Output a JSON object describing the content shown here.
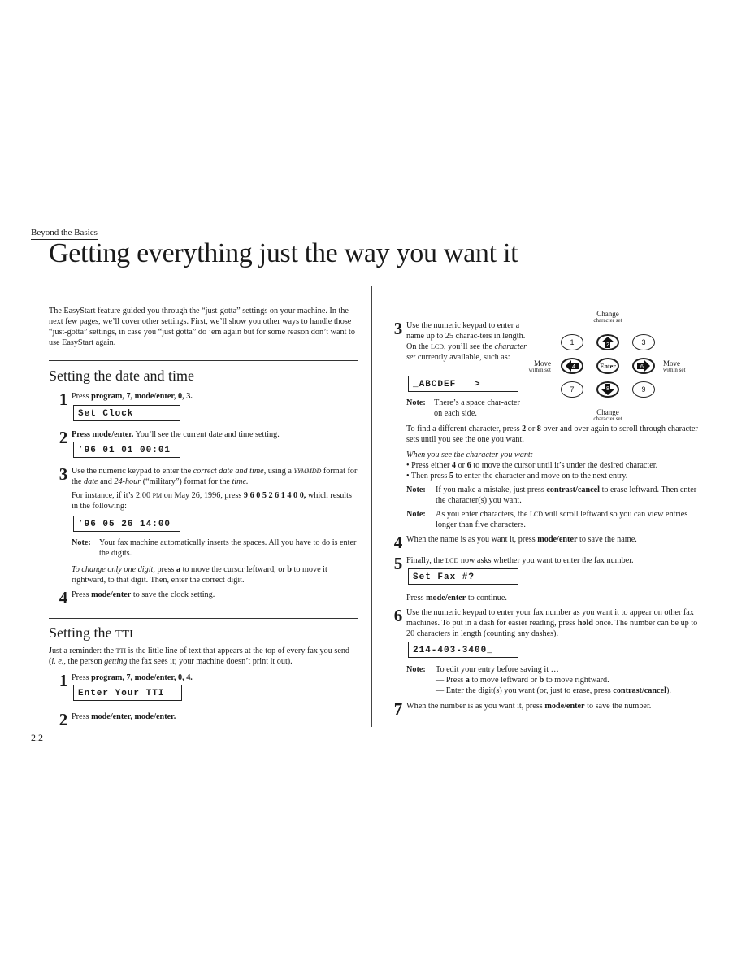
{
  "header": {
    "section_label": "Beyond the Basics",
    "title": "Getting everything just the way you want it"
  },
  "intro": "The EasyStart feature guided you through the “just-gotta” settings on your machine. In the next few pages, we’ll cover other settings. First, we’ll show you other ways to handle those “just-gotta” settings, in case you “just gotta” do ’em again but for some reason don’t want to use EasyStart again.",
  "date_time": {
    "heading": "Setting the date and time",
    "step1": {
      "num": "1",
      "pre": "Press ",
      "bold": "program, 7, mode/enter, 0, 3.",
      "lcd": "Set Clock"
    },
    "step2": {
      "num": "2",
      "bold": "Press mode/enter.",
      "rest": " You’ll see the current date and time setting.",
      "lcd": "’96 01 01 00:01"
    },
    "step3": {
      "num": "3",
      "line_a": "Use the numeric keypad to enter the",
      "italic_a": "correct date and time",
      "line_b": ", using a",
      "format": "YYMMDD",
      "line_c": "format for the",
      "italic_date": "date",
      "line_d": "and",
      "italic_24": "24-hour",
      "line_e": "(“military”) format for the",
      "italic_time": "time.",
      "example_pre": "For instance, if it’s 2:00",
      "pm": "PM",
      "example_mid": "on May 26, 1996, press",
      "example_keys": "9 6 0 5 2 6 1 4 0 0,",
      "example_post": "which results in the following:",
      "lcd": "’96 05 26 14:00",
      "note_label": "Note:",
      "note_text": "Your fax machine automatically inserts the spaces. All you have to do is enter the digits.",
      "change_italic": "To change only one digit,",
      "change_text_a": "press",
      "key_a": "a",
      "change_text_b": "to move the cursor leftward, or",
      "key_b": "b",
      "change_text_c": "to move it rightward, to that digit. Then, enter the correct digit."
    },
    "step4": {
      "num": "4",
      "pre": "Press ",
      "bold": "mode/enter",
      "rest": " to save the clock setting."
    }
  },
  "tti": {
    "heading_pre": "Setting the",
    "heading_sc": "TTI",
    "intro_a": "Just a reminder: the",
    "intro_sc": "TTI",
    "intro_b": "is the little line of text that appears at the top of every fax you send (",
    "intro_ie": "i. e.,",
    "intro_c": "the person",
    "intro_getting": "getting",
    "intro_d": "the fax sees it; your machine doesn’t print it out).",
    "step1": {
      "num": "1",
      "pre": "Press ",
      "bold": "program, 7, mode/enter, 0, 4.",
      "lcd": "Enter Your TTI"
    },
    "step2": {
      "num": "2",
      "pre": "Press ",
      "bold": "mode/enter, mode/enter."
    },
    "step3": {
      "num": "3",
      "text_a": "Use the numeric keypad to enter a name up to 25 charac-ters in length. On the",
      "sc_lcd": "LCD",
      "text_b": ", you’ll see the",
      "italic": "character set",
      "text_c": "currently available, such as:",
      "lcd": "_ABCDEF   >",
      "note_label": "Note:",
      "note_text": "There’s a space char-acter on each side.",
      "find_a": "To find a different character, press",
      "find_k1": "2",
      "find_or": "or",
      "find_k2": "8",
      "find_b": "over and over again to scroll through character sets until you see the one you want.",
      "when_italic": "When you see the character you want:",
      "bullet1_a": "• Press either",
      "bullet1_k1": "4",
      "bullet1_or": "or",
      "bullet1_k2": "6",
      "bullet1_b": "to move the cursor until it’s under the desired character.",
      "bullet2_a": "• Then press",
      "bullet2_k": "5",
      "bullet2_b": "to enter the character and move on to the next entry.",
      "note2_label": "Note:",
      "note2_a": "If you make a mistake, just press",
      "note2_bold": "contrast/cancel",
      "note2_b": "to erase leftward. Then enter the character(s) you want.",
      "note3_label": "Note:",
      "note3_a": "As you enter characters, the",
      "note3_sc": "LCD",
      "note3_b": "will scroll leftward so you can view entries longer than five characters."
    },
    "keypad": {
      "top_label_a": "Change",
      "top_label_b": "character set",
      "bottom_label_a": "Change",
      "bottom_label_b": "character set",
      "left_label_a": "Move",
      "left_label_b": "within set",
      "right_label_a": "Move",
      "right_label_b": "within set",
      "keys": [
        "1",
        "2",
        "3",
        "4",
        "Enter",
        "6",
        "7",
        "8",
        "9"
      ]
    },
    "step4": {
      "num": "4",
      "pre": "When the name is as you want it, press ",
      "bold": "mode/enter",
      "rest": " to save the name."
    },
    "step5": {
      "num": "5",
      "text_a": "Finally, the",
      "sc": "LCD",
      "text_b": "now asks whether you want to enter the fax number.",
      "lcd": "Set Fax #?",
      "cont_pre": "Press ",
      "cont_bold": "mode/enter",
      "cont_rest": " to continue."
    },
    "step6": {
      "num": "6",
      "text_a": "Use the numeric keypad to enter your fax number as you want it to appear on other fax machines. To put in a dash for easier reading, press",
      "bold": "hold",
      "text_b": "once. The number can be up to 20 characters in length (counting any dashes).",
      "lcd": "214-403-3400_",
      "note_label": "Note:",
      "note_line1": "To edit your entry before saving it …",
      "note_line2_a": "— Press",
      "note_line2_ka": "a",
      "note_line2_b": "to move leftward or",
      "note_line2_kb": "b",
      "note_line2_c": "to move rightward.",
      "note_line3_a": "— Enter the digit(s) you want (or, just to erase, press",
      "note_line3_bold": "contrast/cancel",
      "note_line3_b": ")."
    },
    "step7": {
      "num": "7",
      "pre": "When the number is as you want it, press ",
      "bold": "mode/enter",
      "rest": " to save the number."
    }
  },
  "footer": {
    "page_number": "2.2"
  }
}
